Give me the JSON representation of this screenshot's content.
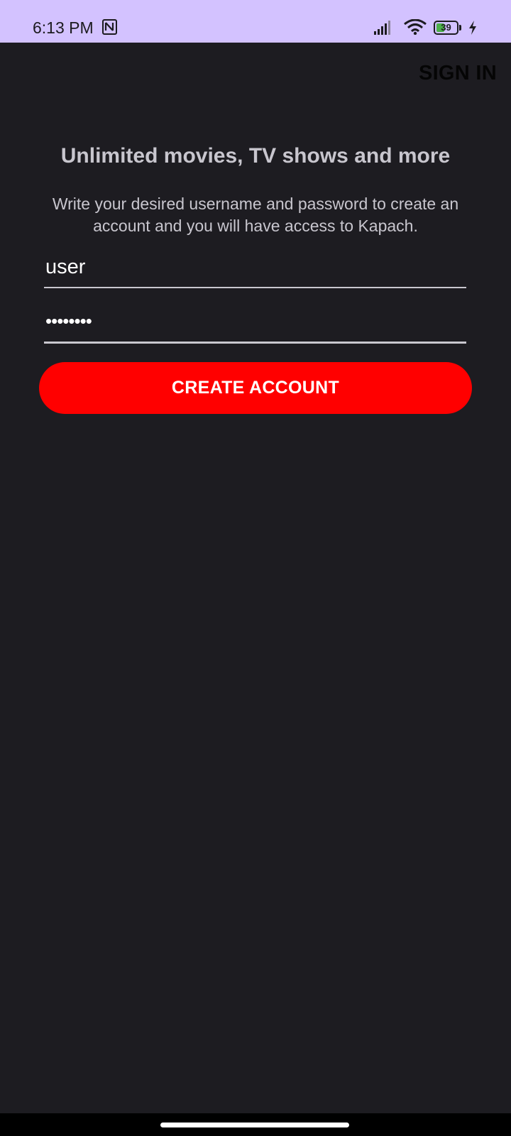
{
  "status_bar": {
    "time": "6:13 PM",
    "battery": "39",
    "icons": [
      "nfc-icon",
      "signal-icon",
      "wifi-icon",
      "battery-icon",
      "charging-icon"
    ]
  },
  "header": {
    "sign_in_label": "SIGN IN"
  },
  "main": {
    "headline": "Unlimited movies, TV shows and more",
    "description": "Write your desired username and password to create an account and you will have access to Kapach.",
    "username_value": "user",
    "password_masked": "••••••••",
    "create_account_label": "CREATE ACCOUNT"
  },
  "colors": {
    "status_bar_background": "#d3c2ff",
    "background": "#1d1c21",
    "primary_button": "#ff0000",
    "text": "#c8c6ce"
  }
}
